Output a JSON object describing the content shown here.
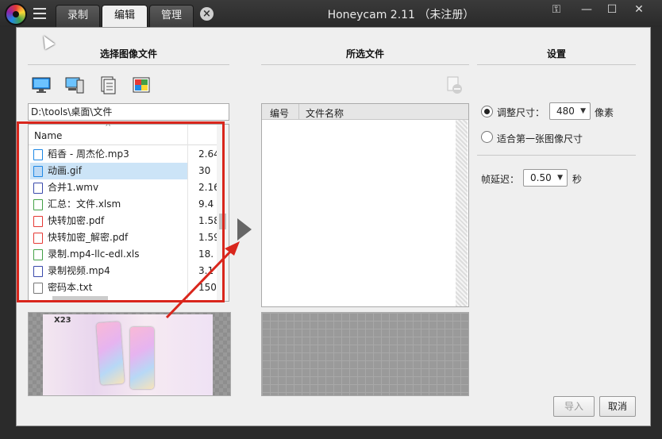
{
  "app": {
    "title": "Honeycam 2.11 （未注册）",
    "tabs": [
      {
        "label": "录制",
        "active": false
      },
      {
        "label": "编辑",
        "active": true
      },
      {
        "label": "管理",
        "active": false
      }
    ],
    "tab_close": "×",
    "window_buttons": {
      "key": "⚿",
      "minimize": "—",
      "maximize": "☐",
      "close": "✕"
    }
  },
  "left": {
    "title": "选择图像文件",
    "toolbar_icons": [
      "desktop-icon",
      "computer-icon",
      "documents-icon",
      "pictures-icon"
    ],
    "path": "D:\\tools\\桌面\\文件",
    "list_header": "Name",
    "sort_glyph": "^",
    "files": [
      {
        "name": "稻香 - 周杰伦.mp3",
        "size": "2.64",
        "icon": "audio-file-icon",
        "selected": false
      },
      {
        "name": "动画.gif",
        "size": "30",
        "icon": "gif-file-icon",
        "selected": true
      },
      {
        "name": "合并1.wmv",
        "size": "2.16",
        "icon": "video-file-icon",
        "selected": false
      },
      {
        "name": "汇总：文件.xlsm",
        "size": "9.4",
        "icon": "excel-file-icon",
        "selected": false
      },
      {
        "name": "快转加密.pdf",
        "size": "1.58",
        "icon": "pdf-file-icon",
        "selected": false
      },
      {
        "name": "快转加密_解密.pdf",
        "size": "1.59",
        "icon": "pdf-file-icon",
        "selected": false
      },
      {
        "name": "录制.mp4-llc-edl.xls",
        "size": "18.",
        "icon": "excel-file-icon",
        "selected": false
      },
      {
        "name": "录制视频.mp4",
        "size": "3.1",
        "icon": "video-file-icon",
        "selected": false
      },
      {
        "name": "密码本.txt",
        "size": "150",
        "icon": "text-file-icon",
        "selected": false
      }
    ],
    "preview_text": "X23"
  },
  "middle": {
    "title": "所选文件",
    "columns": [
      "编号",
      "文件名称"
    ]
  },
  "right": {
    "title": "设置",
    "resize_label": "调整尺寸：",
    "resize_value": "480",
    "resize_unit": "像素",
    "fit_first_label": "适合第一张图像尺寸",
    "delay_label": "帧延迟：",
    "delay_value": "0.50",
    "delay_unit": "秒",
    "resize_selected": true
  },
  "buttons": {
    "import": "导入",
    "cancel": "取消"
  },
  "colors": {
    "highlight": "#d9261c",
    "selection": "#cce4f7",
    "titlebar": "#2b2b2b"
  }
}
